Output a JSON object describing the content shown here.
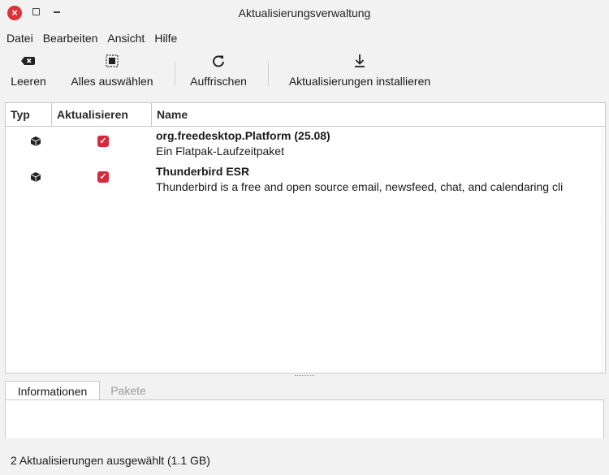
{
  "window": {
    "title": "Aktualisierungsverwaltung",
    "close_glyph": "×"
  },
  "menu": {
    "items": [
      "Datei",
      "Bearbeiten",
      "Ansicht",
      "Hilfe"
    ]
  },
  "toolbar": {
    "clear_label": "Leeren",
    "select_all_label": "Alles auswählen",
    "refresh_label": "Auffrischen",
    "install_label": "Aktualisierungen installieren"
  },
  "table": {
    "columns": [
      "Typ",
      "Aktualisieren",
      "Name"
    ],
    "rows": [
      {
        "type_icon": "package-icon",
        "checked": true,
        "name": "org.freedesktop.Platform (25.08)",
        "description": "Ein Flatpak-Laufzeitpaket"
      },
      {
        "type_icon": "package-icon",
        "checked": true,
        "name": "Thunderbird ESR",
        "description": "Thunderbird is a free and open source email, newsfeed, chat, and calendaring cli"
      }
    ]
  },
  "details": {
    "tabs": [
      "Informationen",
      "Pakete"
    ],
    "active_tab": "Informationen"
  },
  "status": {
    "text": "2 Aktualisierungen ausgewählt (1.1 GB)"
  },
  "colors": {
    "accent": "#d62a3c",
    "close_button": "#e0303a"
  }
}
